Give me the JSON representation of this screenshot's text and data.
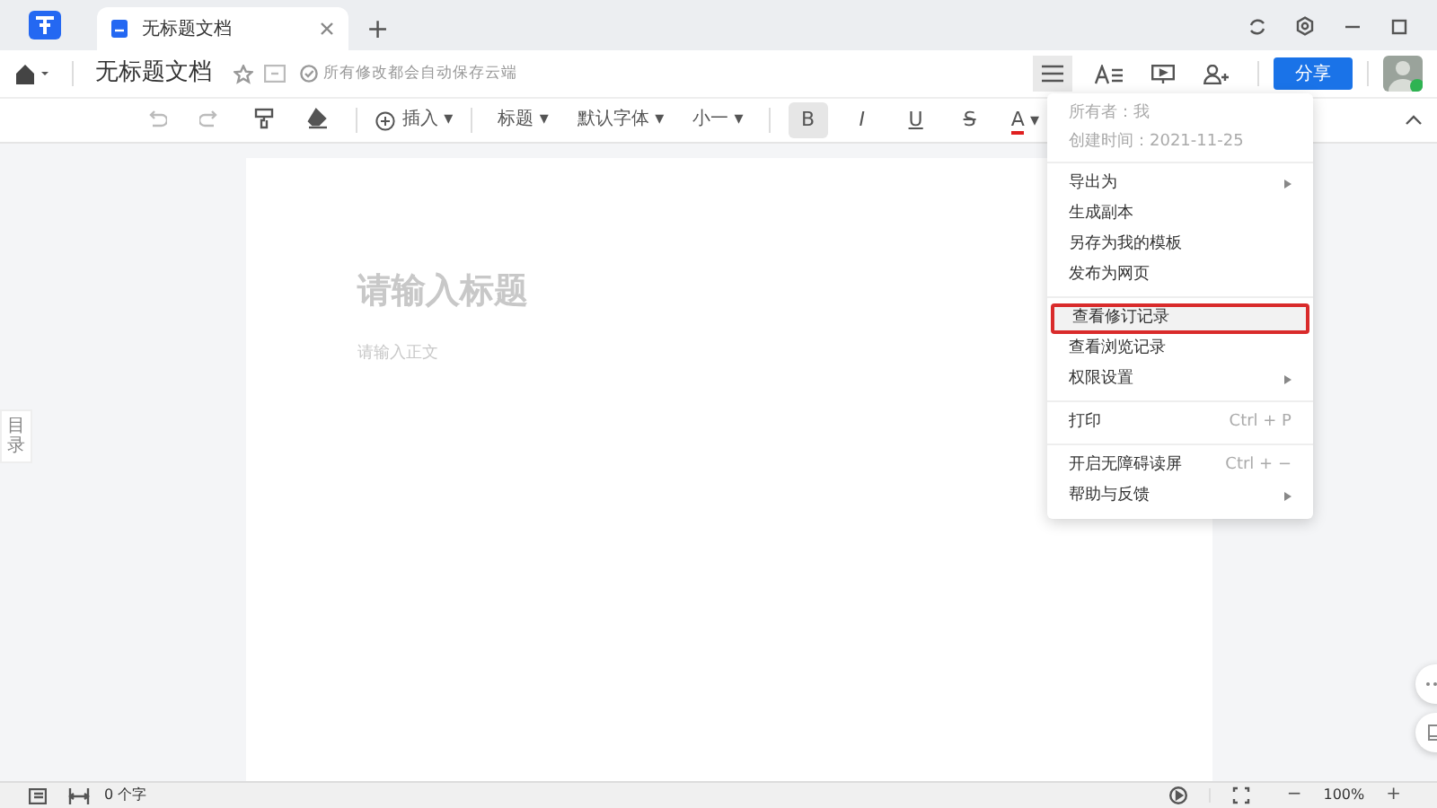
{
  "tabs": [
    {
      "label": "无标题文档",
      "selected": true
    }
  ],
  "new_tab": "+",
  "header": {
    "title": "无标题文档",
    "save_status": "所有修改都会自动保存云端",
    "share": "分享"
  },
  "toolbar": [
    {
      "kind": "undo",
      "disabled": true
    },
    {
      "kind": "redo",
      "disabled": true
    },
    {
      "kind": "painter"
    },
    {
      "kind": "eraser"
    },
    {
      "kind": "sep"
    },
    {
      "kind": "insert",
      "label": "插入",
      "caret": "▾"
    },
    {
      "kind": "sep"
    },
    {
      "kind": "dropdown",
      "label": "标题",
      "caret": "▾"
    },
    {
      "kind": "dropdown",
      "label": "默认字体",
      "caret": "▾"
    },
    {
      "kind": "dropdown",
      "label": "小一",
      "caret": "▾"
    },
    {
      "kind": "sep"
    },
    {
      "kind": "bold",
      "label": "B",
      "selected": true
    },
    {
      "kind": "italic",
      "label": "I",
      "selected": false
    },
    {
      "kind": "underline",
      "label": "U",
      "selected": false
    },
    {
      "kind": "strike",
      "label": "S",
      "selected": false
    },
    {
      "kind": "color",
      "label": "A",
      "caret": "▾",
      "color": "#e02020"
    }
  ],
  "toc_tab": "目录",
  "document": {
    "title_placeholder": "请输入标题",
    "body_placeholder": "请输入正文"
  },
  "menu": {
    "info": [
      "所有者：我",
      "创建时间：2021-11-25"
    ],
    "groups": [
      [
        {
          "label": "导出为",
          "submenu": true,
          "outlined": false
        },
        {
          "label": "生成副本",
          "submenu": false,
          "outlined": false
        },
        {
          "label": "另存为我的模板",
          "submenu": false,
          "outlined": false
        },
        {
          "label": "发布为网页",
          "submenu": false,
          "outlined": false
        }
      ],
      [
        {
          "label": "查看修订记录",
          "submenu": false,
          "outlined": true
        },
        {
          "label": "查看浏览记录",
          "submenu": false,
          "outlined": false
        },
        {
          "label": "权限设置",
          "submenu": true,
          "outlined": false
        }
      ],
      [
        {
          "label": "打印",
          "shortcut": "Ctrl + P",
          "submenu": false,
          "outlined": false
        }
      ],
      [
        {
          "label": "开启无障碍读屏",
          "shortcut": "Ctrl + −",
          "submenu": false,
          "outlined": false
        },
        {
          "label": "帮助与反馈",
          "submenu": true,
          "outlined": false
        }
      ]
    ]
  },
  "status_bar": {
    "word_count": "0 个字",
    "zoom_out": "−",
    "zoom": "100%",
    "zoom_in": "+"
  }
}
